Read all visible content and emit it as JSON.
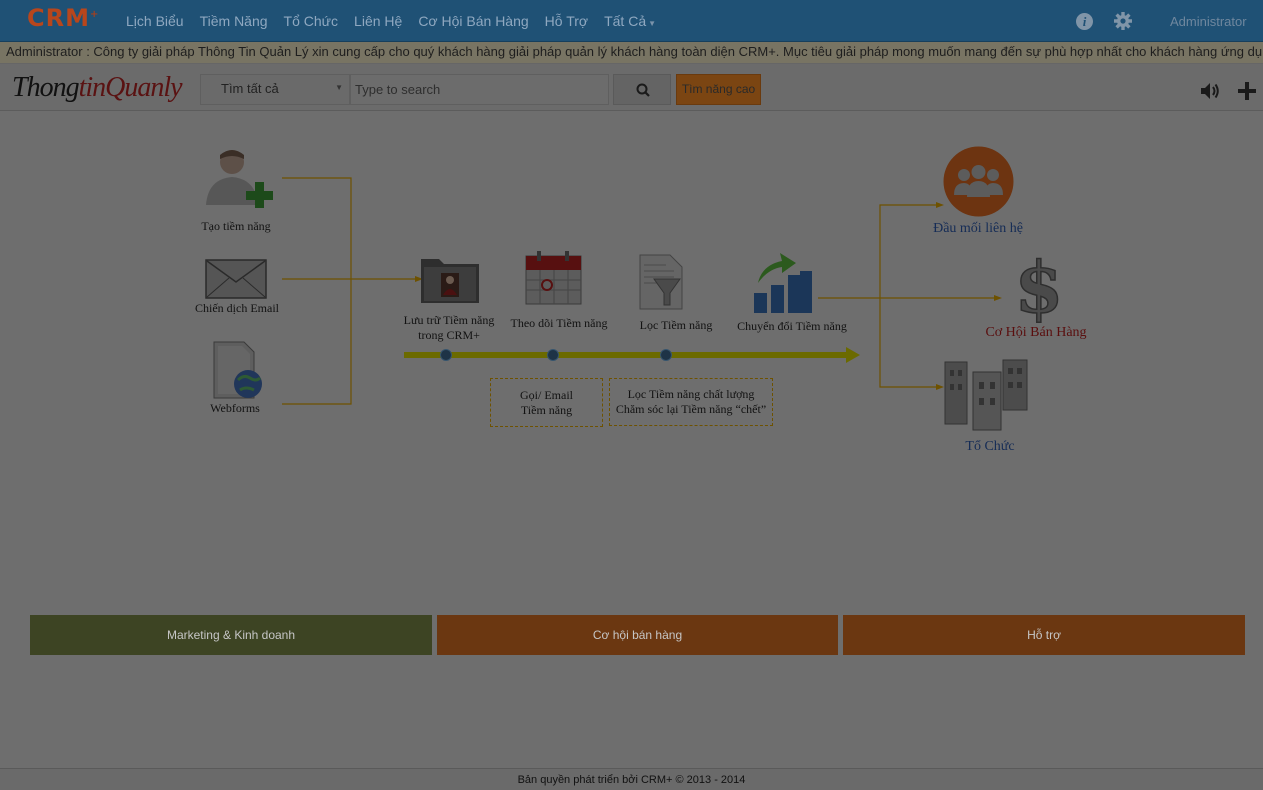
{
  "app": {
    "logo": "CRM",
    "logo_mark": "+"
  },
  "nav": {
    "items": [
      "Lịch Biểu",
      "Tiềm Năng",
      "Tổ Chức",
      "Liên Hệ",
      "Cơ Hội Bán Hàng",
      "Hỗ Trợ",
      "Tất Cả"
    ],
    "admin": "Administrator"
  },
  "marquee": {
    "text": "Administrator : Công ty giải pháp Thông Tin Quản Lý xin cung cấp cho quý khách hàng giải pháp quản lý khách hàng toàn diện CRM+. Mục tiêu giải pháp mong muốn mang đến sự phù hợp nhất cho khách hàng ứng dụng. Trong quá trình"
  },
  "toolbar": {
    "brand_a": "Thong",
    "brand_b": "tinQuanly",
    "search_scope": "Tìm tất cả",
    "search_placeholder": "Type to search",
    "advanced_search": "Tìm năng cao"
  },
  "diagram": {
    "sources": [
      "Tạo tiềm năng",
      "Chiến dịch Email",
      "Webforms"
    ],
    "steps": {
      "store_line1": "Lưu trữ Tiềm năng",
      "store_line2": "trong CRM+",
      "track": "Theo dõi Tiềm năng",
      "filter": "Lọc Tiềm năng",
      "convert": "Chuyển đổi Tiềm năng"
    },
    "notes": {
      "call_line1": "Gọi/ Email",
      "call_line2": "Tiềm năng",
      "quality_line1": "Lọc Tiềm năng chất lượng",
      "quality_line2": "Chăm sóc lại Tiềm năng “chết”"
    },
    "outputs": {
      "contact": "Đầu mối liên hệ",
      "opportunity": "Cơ Hội Bán Hàng",
      "organization": "Tổ Chức"
    }
  },
  "categories": [
    "Marketing & Kinh doanh",
    "Cơ hội bán hàng",
    "Hỗ trợ"
  ],
  "footer": "Bản quyền phát triển bởi CRM+  © 2013 - 2014",
  "colors": {
    "nav_bg": "#1f5175",
    "arrow_line": "#6e5200",
    "timeline": "#6b6a00",
    "marketing": "#3d4423",
    "orange": "#6b3711"
  }
}
